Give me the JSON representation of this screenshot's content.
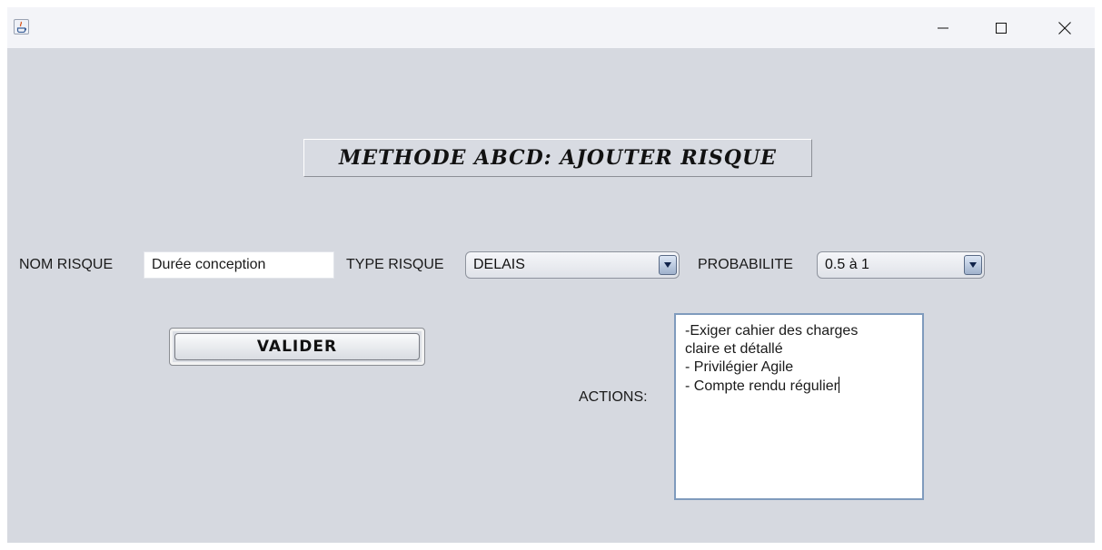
{
  "window": {
    "title": "",
    "controls": {
      "minimize_icon": "minimize-icon",
      "maximize_icon": "maximize-icon",
      "close_icon": "close-icon"
    }
  },
  "form": {
    "heading": "METHODE ABCD: AJOUTER RISQUE",
    "nom_risque": {
      "label": "NOM RISQUE",
      "value": "Durée conception"
    },
    "type_risque": {
      "label": "TYPE RISQUE",
      "selected": "DELAIS"
    },
    "probabilite": {
      "label": "PROBABILITE",
      "selected": "0.5 à 1"
    },
    "valider_label": "VALIDER",
    "actions": {
      "label": "ACTIONS:",
      "lines": [
        "-Exiger cahier des charges",
        "claire et détallé",
        "- Privilégier Agile",
        "- Compte rendu régulier"
      ]
    }
  },
  "colors": {
    "background": "#d6d9e0",
    "titlebar": "#f3f4f8",
    "textarea_border": "#7f9bbd"
  }
}
